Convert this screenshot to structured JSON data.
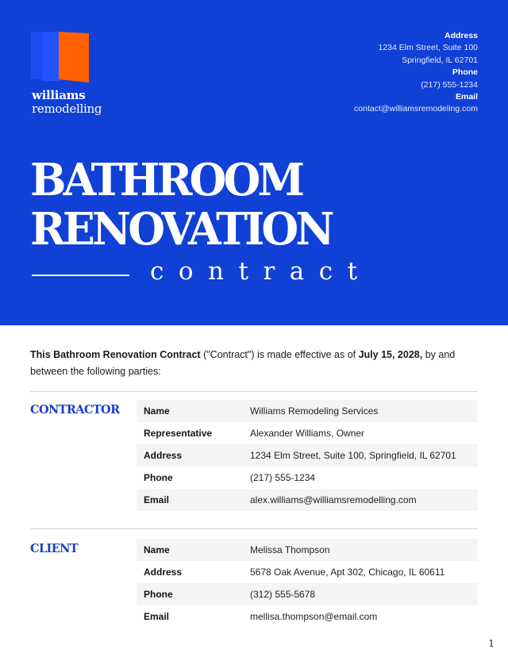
{
  "brand": {
    "name_line1": "williams",
    "name_line2": "remodelling",
    "logo_colors": {
      "panel_dark": "#1a4cf0",
      "panel_mid": "#2154ff",
      "panel_accent": "#ff6000"
    }
  },
  "contact": {
    "address_label": "Address",
    "address_line1": "1234 Elm Street, Suite 100",
    "address_line2": "Springfield, IL 62701",
    "phone_label": "Phone",
    "phone": "(217) 555-1234",
    "email_label": "Email",
    "email": "contact@williamsremodeling.com"
  },
  "title": {
    "line1": "BATHROOM",
    "line2": "RENOVATION",
    "subtitle": "contract"
  },
  "intro": {
    "bold_lead": "This Bathroom Renovation Contract",
    "text1": " (\"Contract\") is made effective as of ",
    "bold_date": "July 15, 2028,",
    "text2": " by and between the following parties:"
  },
  "contractor": {
    "label": "CONTRACTOR",
    "rows": [
      {
        "key": "Name",
        "value": "Williams Remodeling Services"
      },
      {
        "key": "Representative",
        "value": "Alexander Williams, Owner"
      },
      {
        "key": "Address",
        "value": "1234 Elm Street, Suite 100, Springfield, IL 62701"
      },
      {
        "key": "Phone",
        "value": "(217) 555-1234"
      },
      {
        "key": "Email",
        "value": "alex.williams@williamsremodelling.com"
      }
    ]
  },
  "client": {
    "label": "CLIENT",
    "rows": [
      {
        "key": "Name",
        "value": "Melissa Thompson"
      },
      {
        "key": "Address",
        "value": "5678 Oak Avenue, Apt 302, Chicago, IL 60611"
      },
      {
        "key": "Phone",
        "value": "(312) 555-5678"
      },
      {
        "key": "Email",
        "value": "mellisa.thompson@email.com"
      }
    ]
  },
  "colors": {
    "hero_background": "#1040d6",
    "section_label": "#1a3fc9",
    "row_stripe": "#f4f4f4"
  },
  "page_number": "1"
}
